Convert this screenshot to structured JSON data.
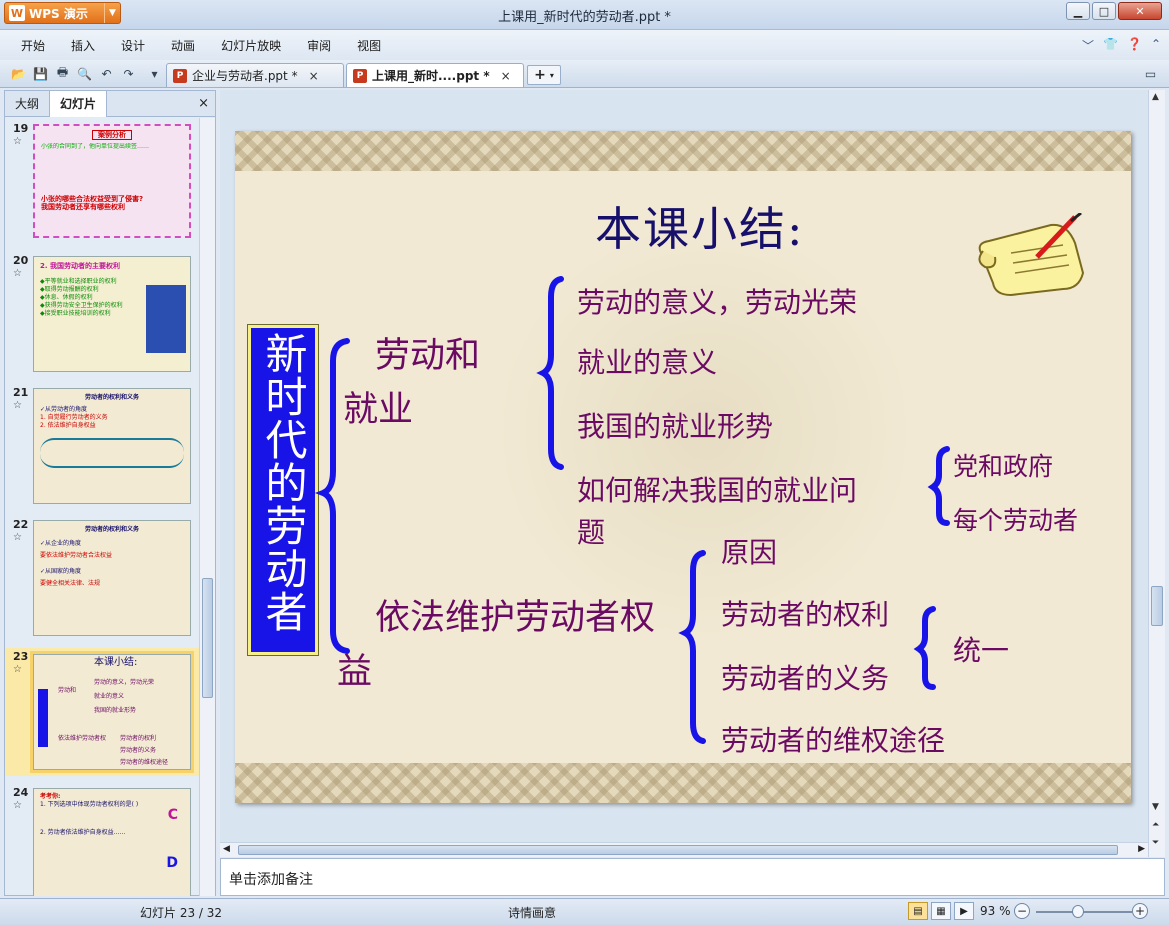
{
  "app": {
    "button_label": "WPS 演示",
    "window_title": "上课用_新时代的劳动者.ppt *"
  },
  "menu": [
    "开始",
    "插入",
    "设计",
    "动画",
    "幻灯片放映",
    "审阅",
    "视图"
  ],
  "doc_tabs": [
    {
      "label": "企业与劳动者.ppt *",
      "close": "×"
    },
    {
      "label": "上课用_新时....ppt *",
      "close": "×"
    }
  ],
  "left_panel": {
    "tabs": [
      "大纲",
      "幻灯片"
    ],
    "close": "×"
  },
  "thumbnails": [
    {
      "num": "19",
      "lines": [
        "案例分析",
        "小张的合同到了，他向单位提出续签……",
        "小张的哪些合法权益受到了侵害?",
        "我国劳动者还享有哪些权利"
      ]
    },
    {
      "num": "20",
      "lines": [
        "2. 我国劳动者的主要权利",
        "◆平等就业和选择职业的权利",
        "◆取得劳动报酬的权利",
        "◆休息、休假的权利",
        "◆获得劳动安全卫生保护的权利",
        "◆接受职业技能培训的权利"
      ]
    },
    {
      "num": "21",
      "lines": [
        "劳动者的权利和义务",
        "✓从劳动者的角度",
        "1. 自觉履行劳动者的义务",
        "2. 依法维护自身权益"
      ]
    },
    {
      "num": "22",
      "lines": [
        "劳动者的权利和义务",
        "✓从企业的角度",
        "要依法维护劳动者合法权益",
        "✓从国家的角度",
        "要健全相关法律、法规"
      ]
    },
    {
      "num": "23",
      "lines": []
    },
    {
      "num": "24",
      "lines": [
        "考考你:",
        "1. 下列选项中体现劳动者权利的是( )",
        "C",
        "2. 劳动者依法维护自身权益……",
        "D"
      ]
    }
  ],
  "slide": {
    "title": "本课小结:",
    "vertical_heading": "新时代的劳动者",
    "branch1": {
      "label_line1": "劳动和",
      "label_line2": "就业"
    },
    "branch1_items": [
      "劳动的意义，劳动光荣",
      "就业的意义",
      "我国的就业形势",
      "如何解决我国的就业问",
      "题"
    ],
    "branch1_sub": [
      "党和政府",
      "每个劳动者"
    ],
    "branch2": {
      "label_line1": "依法维护劳动者权",
      "label_line2": "益"
    },
    "branch2_items": [
      "原因",
      "劳动者的权利",
      "劳动者的义务",
      "劳动者的维权途径"
    ],
    "branch2_sub": "统一"
  },
  "notes_placeholder": "单击添加备注",
  "status": {
    "slide": "幻灯片 23 / 32",
    "theme": "诗情画意",
    "zoom": "93 %"
  },
  "colors": {
    "accent_blue": "#1814e8",
    "text_purple": "#6b0a63",
    "title_navy": "#16106b"
  }
}
